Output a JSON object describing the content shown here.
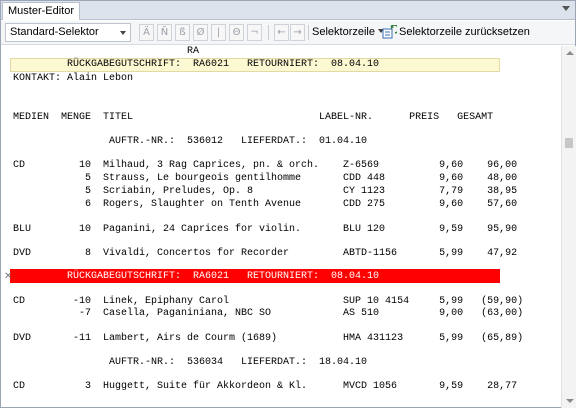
{
  "window": {
    "title": "Muster-Editor"
  },
  "toolbar": {
    "selector_value": "Standard-Selektor",
    "char_buttons": [
      "Ä",
      "Ñ",
      "ß",
      "Ø",
      "|",
      "Θ",
      "¬"
    ],
    "arrow_left": "←",
    "arrow_right": "→",
    "selektorzeile_label": "Selektorzeile",
    "reset_label": "Selektorzeile zurücksetzen"
  },
  "document": {
    "selector_line": "RA",
    "lines": [
      "KONTAKT: Alain Lebon",
      "MEDIEN  MENGE  TITEL                               LABEL-NR.      PREIS   GESAMT",
      "                AUFTR.-NR.:  536012   LIEFERDAT.:  01.04.10",
      "CD         10  Milhaud, 3 Rag Caprices, pn. & orch.    Z-6569          9,60    96,00",
      "            5  Strauss, Le bourgeois gentilhomme       CDD 448         9,60    48,00",
      "            5  Scriabin, Preludes, Op. 8               CY 1123         7,79    38,95",
      "            6  Rogers, Slaughter on Tenth Avenue       CDD 275         9,60    57,60",
      "BLU        10  Paganini, 24 Caprices for violin.       BLU 120         9,59    95,90",
      "DVD         8  Vivaldi, Concertos for Recorder         ABTD-1156       5,99    47,92",
      "CD        -10  Linek, Epiphany Carol                   SUP 10 4154     5,99   (59,90)",
      "           -7  Casella, Paganiniana, NBC SO            AS 510          9,00   (63,00)",
      "DVD       -11  Lambert, Airs de Courm (1689)           HMA 431123      5,99   (65,89)",
      "                AUFTR.-NR.:  536034   LIEFERDAT.:  18.04.10",
      "CD          3  Huggett, Suite für Akkordeon & Kl.      MVCD 1056       9,59    28,77"
    ],
    "band_text": "RÜCKGABEGUTSCHRIFT:  RA6021   RETOURNIERT:  08.04.10",
    "marker_glyph": "✕"
  },
  "colors": {
    "highlight_yellow": "#fcf8d2",
    "highlight_red": "#ff0000"
  }
}
